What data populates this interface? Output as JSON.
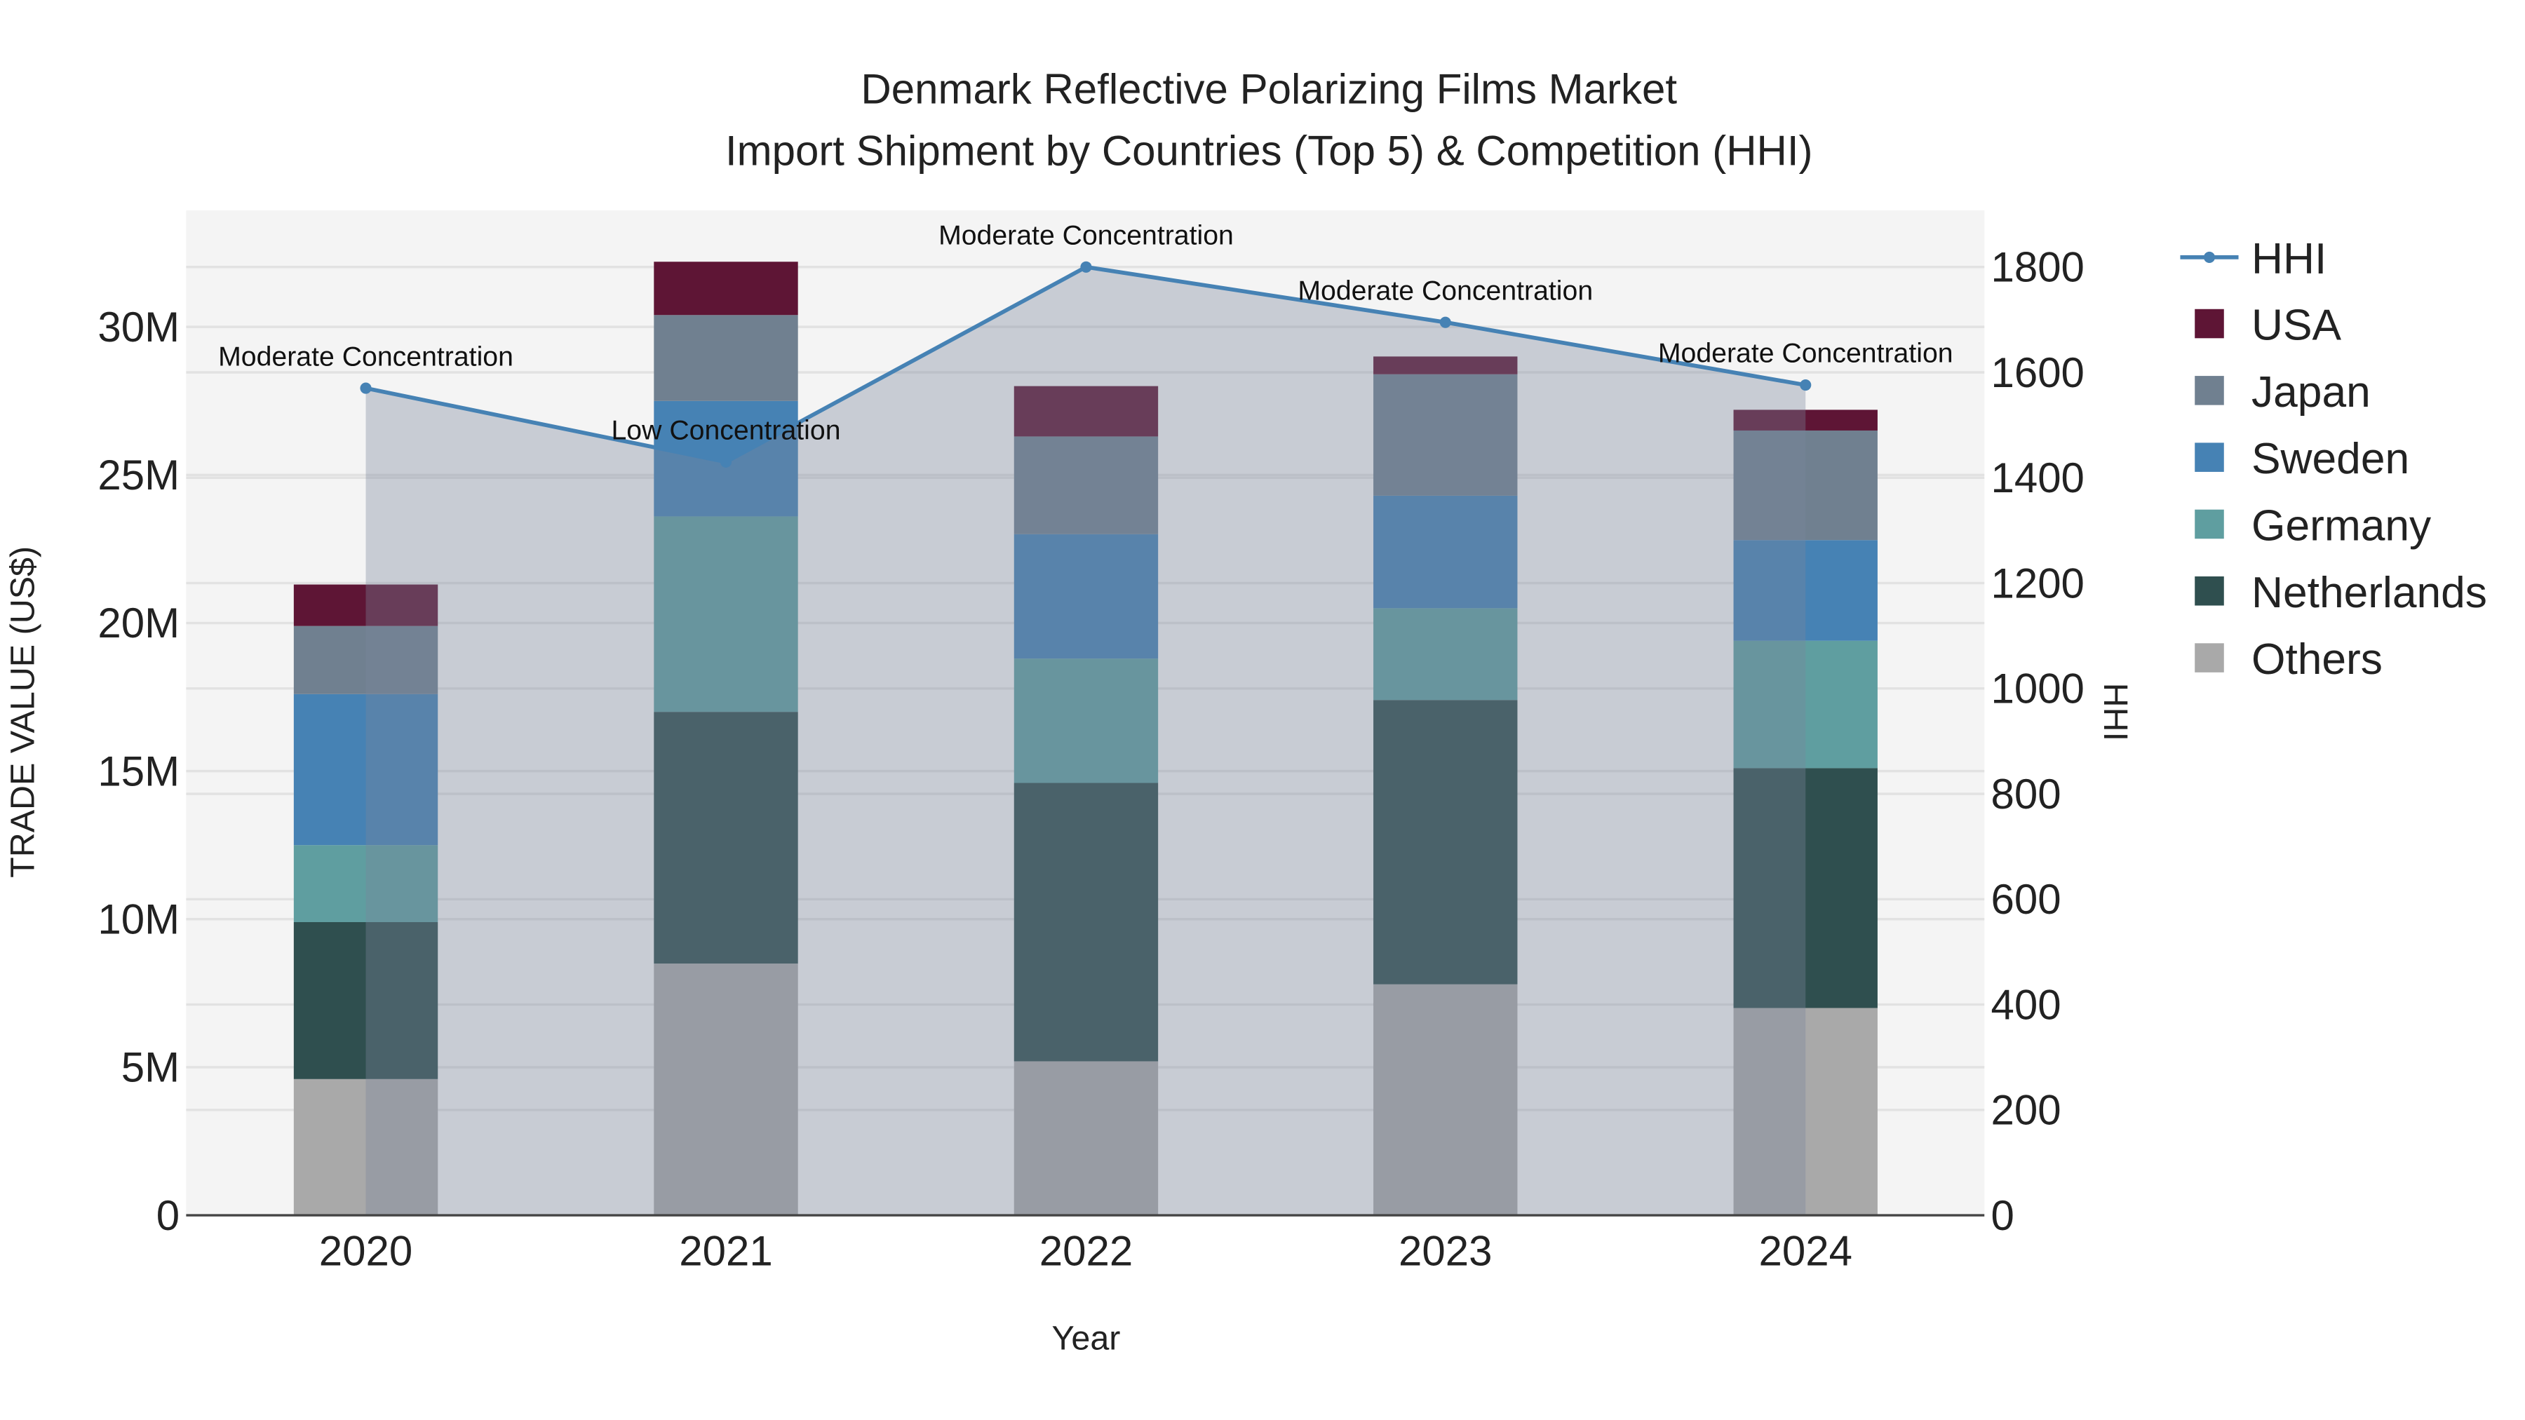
{
  "chart_data": {
    "type": "bar",
    "title_line1": "Denmark Reflective Polarizing Films Market",
    "title_line2": "Import Shipment by Countries (Top 5) & Competition (HHI)",
    "xlabel": "Year",
    "ylabel": "TRADE VALUE (US$)",
    "y2label": "HHI",
    "categories": [
      "2020",
      "2021",
      "2022",
      "2023",
      "2024"
    ],
    "ylim": [
      0,
      34
    ],
    "y_ticks": [
      0,
      5,
      10,
      15,
      20,
      25,
      30
    ],
    "y_tick_labels": [
      "0",
      "5M",
      "10M",
      "15M",
      "20M",
      "25M",
      "30M"
    ],
    "y2lim": [
      0,
      1900
    ],
    "y2_ticks": [
      0,
      200,
      400,
      600,
      800,
      1000,
      1200,
      1400,
      1600,
      1800
    ],
    "y2_tick_labels": [
      "0",
      "200",
      "400",
      "600",
      "800",
      "1000",
      "1200",
      "1400",
      "1600",
      "1800"
    ],
    "series": [
      {
        "name": "Others",
        "color": "#a9a9a9",
        "values": [
          4.6,
          8.5,
          5.2,
          7.8,
          7.0
        ]
      },
      {
        "name": "Netherlands",
        "color": "#2f4f4f",
        "values": [
          5.3,
          8.5,
          9.4,
          9.6,
          8.1
        ]
      },
      {
        "name": "Germany",
        "color": "#5f9ea0",
        "values": [
          2.6,
          6.6,
          4.2,
          3.1,
          4.3
        ]
      },
      {
        "name": "Sweden",
        "color": "#4682b4",
        "values": [
          5.1,
          3.9,
          4.2,
          3.8,
          3.4
        ]
      },
      {
        "name": "Japan",
        "color": "#708090",
        "values": [
          2.3,
          2.9,
          3.3,
          4.1,
          3.7
        ]
      },
      {
        "name": "USA",
        "color": "#5e1535",
        "values": [
          1.4,
          1.8,
          1.7,
          0.6,
          0.7
        ]
      }
    ],
    "hhi": {
      "name": "HHI",
      "color": "#4682b4",
      "values": [
        1570,
        1430,
        1800,
        1695,
        1576
      ],
      "annotations": [
        "Moderate Concentration",
        "Low Concentration",
        "Moderate Concentration",
        "Moderate Concentration",
        "Moderate Concentration"
      ]
    },
    "legend": [
      "HHI",
      "USA",
      "Japan",
      "Sweden",
      "Germany",
      "Netherlands",
      "Others"
    ],
    "legend_placement": "right",
    "grid": true
  }
}
